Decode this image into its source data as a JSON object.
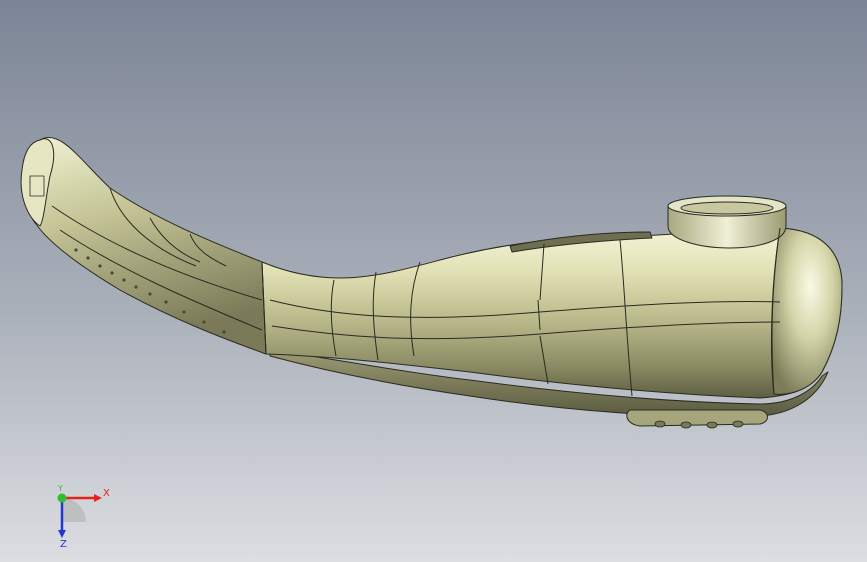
{
  "viewport": {
    "model": "handheld-device-shell",
    "background_top": "#7e8797",
    "background_bottom": "#d8dade",
    "body_color": "#d6d6a8",
    "edge_color": "#2a2a20"
  },
  "triad": {
    "x_label": "X",
    "y_label": "Y",
    "z_label": "Z",
    "x_color": "#e8201e",
    "y_color": "#2fbf2f",
    "z_color": "#2038d0"
  }
}
